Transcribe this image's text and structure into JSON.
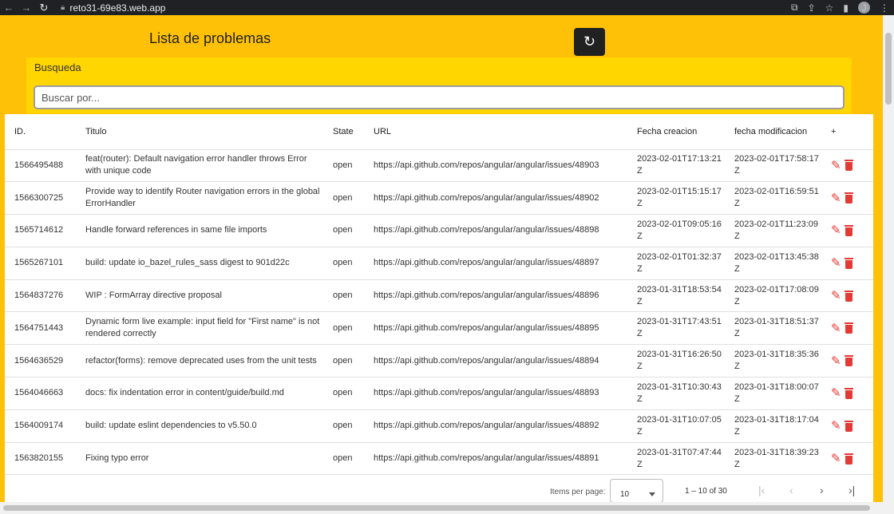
{
  "browser": {
    "url": "reto31-69e83.web.app",
    "avatar_letter": "J"
  },
  "header": {
    "title": "Lista de problemas"
  },
  "search": {
    "label": "Busqueda",
    "placeholder": "Buscar por..."
  },
  "table": {
    "headers": {
      "id": "ID.",
      "titulo": "Titulo",
      "state": "State",
      "url": "URL",
      "fecha_creacion": "Fecha creacion",
      "fecha_modificacion": "fecha modificacion",
      "add": "+"
    },
    "rows": [
      {
        "id": "1566495488",
        "titulo": "feat(router): Default navigation error handler throws Error with unique code",
        "state": "open",
        "url": "https://api.github.com/repos/angular/angular/issues/48903",
        "creacion": "2023-02-01T17:13:21Z",
        "modificacion": "2023-02-01T17:58:17Z"
      },
      {
        "id": "1566300725",
        "titulo": "Provide way to identify Router navigation errors in the global ErrorHandler",
        "state": "open",
        "url": "https://api.github.com/repos/angular/angular/issues/48902",
        "creacion": "2023-02-01T15:15:17Z",
        "modificacion": "2023-02-01T16:59:51Z"
      },
      {
        "id": "1565714612",
        "titulo": "Handle forward references in same file imports",
        "state": "open",
        "url": "https://api.github.com/repos/angular/angular/issues/48898",
        "creacion": "2023-02-01T09:05:16Z",
        "modificacion": "2023-02-01T11:23:09Z"
      },
      {
        "id": "1565267101",
        "titulo": "build: update io_bazel_rules_sass digest to 901d22c",
        "state": "open",
        "url": "https://api.github.com/repos/angular/angular/issues/48897",
        "creacion": "2023-02-01T01:32:37Z",
        "modificacion": "2023-02-01T13:45:38Z"
      },
      {
        "id": "1564837276",
        "titulo": "WIP : FormArray directive proposal",
        "state": "open",
        "url": "https://api.github.com/repos/angular/angular/issues/48896",
        "creacion": "2023-01-31T18:53:54Z",
        "modificacion": "2023-02-01T17:08:09Z"
      },
      {
        "id": "1564751443",
        "titulo": "Dynamic form live example: input field for \"First name\" is not rendered correctly",
        "state": "open",
        "url": "https://api.github.com/repos/angular/angular/issues/48895",
        "creacion": "2023-01-31T17:43:51Z",
        "modificacion": "2023-01-31T18:51:37Z"
      },
      {
        "id": "1564636529",
        "titulo": "refactor(forms): remove deprecated uses from the unit tests",
        "state": "open",
        "url": "https://api.github.com/repos/angular/angular/issues/48894",
        "creacion": "2023-01-31T16:26:50Z",
        "modificacion": "2023-01-31T18:35:36Z"
      },
      {
        "id": "1564046663",
        "titulo": "docs: fix indentation error in content/guide/build.md",
        "state": "open",
        "url": "https://api.github.com/repos/angular/angular/issues/48893",
        "creacion": "2023-01-31T10:30:43Z",
        "modificacion": "2023-01-31T18:00:07Z"
      },
      {
        "id": "1564009174",
        "titulo": "build: update eslint dependencies to v5.50.0",
        "state": "open",
        "url": "https://api.github.com/repos/angular/angular/issues/48892",
        "creacion": "2023-01-31T10:07:05Z",
        "modificacion": "2023-01-31T18:17:04Z"
      },
      {
        "id": "1563820155",
        "titulo": "Fixing typo error",
        "state": "open",
        "url": "https://api.github.com/repos/angular/angular/issues/48891",
        "creacion": "2023-01-31T07:47:44Z",
        "modificacion": "2023-01-31T18:39:23Z"
      }
    ]
  },
  "paginator": {
    "items_label": "Items per page:",
    "page_size": "10",
    "range": "1 – 10 of 30"
  },
  "colors": {
    "page_bg": "#ffc107",
    "search_bg": "#ffd600",
    "action_red": "#e53935",
    "refresh_bg": "#212121"
  }
}
